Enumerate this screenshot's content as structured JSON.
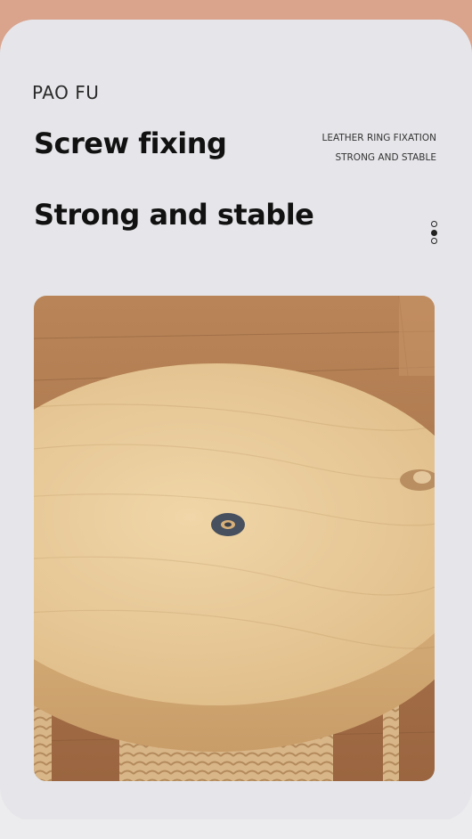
{
  "brand": "PAO FU",
  "headline": {
    "line1": "Screw fixing",
    "line2": "Strong and stable"
  },
  "side_notes": {
    "line1": "LEATHER RING FIXATION",
    "line2": "STRONG AND STABLE"
  },
  "icons": {
    "more": "more-vertical-icon"
  },
  "colors": {
    "accent_band": "#d9a38c",
    "card_bg": "#e6e6ea",
    "wood_light": "#e8c99a",
    "floor_wood": "#a6724a"
  }
}
